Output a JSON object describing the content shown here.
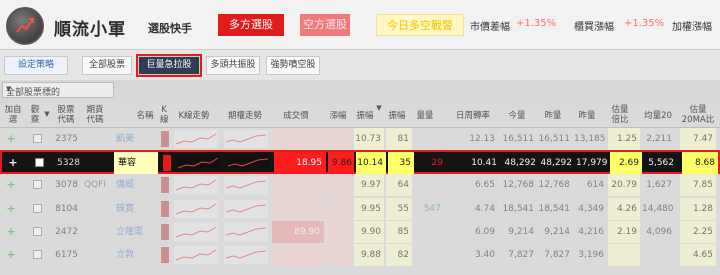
{
  "header": {
    "app_name": "順流小軍",
    "app_subtitle": "選股快手",
    "btn_long": "多方選股",
    "btn_short": "空方選股",
    "btn_today": "今日多空戰警",
    "stat1_label": "市價差幅",
    "stat1_value": "+1.35%",
    "stat2_label": "櫃買漲幅",
    "stat2_value": "+1.35%",
    "stat3_label": "加權漲幅"
  },
  "tabs": {
    "settings": "設定策略",
    "all": "全部股票",
    "volume_surge": "巨量急拉股",
    "long_trend": "多頭共振股",
    "strong_short": "強勢噴空股"
  },
  "selector": {
    "value": "全部股票標的"
  },
  "columns": {
    "add": "加自選",
    "watch": "觀察",
    "code": "股票代碼",
    "futures": "期貨代碼",
    "name": "名稱",
    "kchart": "K線",
    "trend": "K線走勢",
    "intraday": "期權走勢",
    "price": "成交價",
    "change": "漲幅",
    "amp1": "振幅",
    "amp2": "振幅",
    "volume": "量量",
    "turnover": "日周轉率",
    "today_vol": "今量",
    "vol2": "昨量",
    "vol3": "昨量",
    "ratio": "估量倍比",
    "avg20": "均量20",
    "ratio20": "估量20MA比"
  },
  "rows": [
    {
      "code": "2375",
      "futures": "",
      "name": "凱美",
      "price": "",
      "change": "",
      "amp1": "10.73",
      "amp2": "81",
      "vol": "",
      "turnover": "12.13",
      "v1": "16,511",
      "v2": "16,511",
      "v3": "13,185",
      "ratio": "1.25",
      "avg20": "2,211",
      "ratio20": "7.47"
    },
    {
      "code": "5328",
      "futures": "",
      "name": "華容",
      "price": "18.95",
      "change": "9.86",
      "amp1": "10.14",
      "amp2": "35",
      "vol": "29",
      "turnover": "10.41",
      "v1": "48,292",
      "v2": "48,292",
      "v3": "17,979",
      "ratio": "2.69",
      "avg20": "5,562",
      "ratio20": "8.68"
    },
    {
      "code": "3078",
      "futures": "QQFI",
      "name": "僑威",
      "price": "",
      "change": "",
      "amp1": "9.97",
      "amp2": "64",
      "vol": "",
      "turnover": "6.65",
      "v1": "12,768",
      "v2": "12,768",
      "v3": "614",
      "ratio": "20.79",
      "avg20": "1,627",
      "ratio20": "7.85"
    },
    {
      "code": "8104",
      "futures": "",
      "name": "錸寶",
      "price": "",
      "change": "",
      "amp1": "9.95",
      "amp2": "55",
      "vol": "547",
      "turnover": "4.74",
      "v1": "18,541",
      "v2": "18,541",
      "v3": "4,349",
      "ratio": "4.26",
      "avg20": "14,480",
      "ratio20": "1.28"
    },
    {
      "code": "2472",
      "futures": "",
      "name": "立隆電",
      "price": "89.90",
      "change": "",
      "amp1": "9.90",
      "amp2": "85",
      "vol": "",
      "turnover": "6.09",
      "v1": "9,214",
      "v2": "9,214",
      "v3": "4,216",
      "ratio": "2.19",
      "avg20": "4,096",
      "ratio20": "2.25"
    },
    {
      "code": "6175",
      "futures": "",
      "name": "立敦",
      "price": "",
      "change": "",
      "amp1": "9.88",
      "amp2": "82",
      "vol": "",
      "turnover": "3.40",
      "v1": "7,827",
      "v2": "7,827",
      "v3": "3,196",
      "ratio": "",
      "avg20": "",
      "ratio20": "4.65"
    }
  ],
  "colors": {
    "accent_red": "#e31b1b",
    "highlight_yellow": "#ffff99",
    "navy": "#2f3c54"
  }
}
